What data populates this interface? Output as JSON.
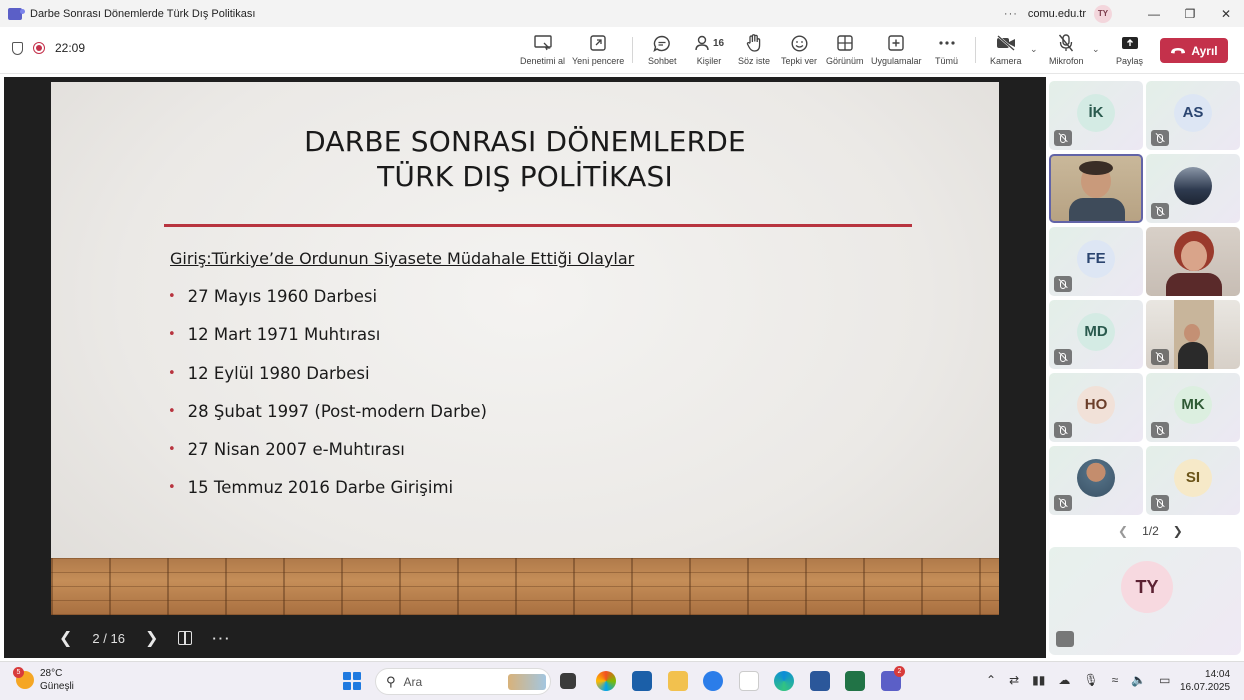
{
  "window": {
    "title": "Darbe Sonrası Dönemlerde Türk Dış Politikası",
    "more": "···",
    "domain": "comu.edu.tr",
    "user_initials": "TY"
  },
  "toolbar": {
    "duration": "22:09",
    "items": [
      {
        "label": "Denetimi al",
        "icon": "take-control-icon"
      },
      {
        "label": "Yeni pencere",
        "icon": "new-window-icon"
      },
      {
        "label": "Sohbet",
        "icon": "chat-icon"
      },
      {
        "label": "Kişiler",
        "icon": "people-icon",
        "count": "16"
      },
      {
        "label": "Söz iste",
        "icon": "raise-hand-icon"
      },
      {
        "label": "Tepki ver",
        "icon": "react-icon"
      },
      {
        "label": "Görünüm",
        "icon": "view-icon"
      },
      {
        "label": "Uygulamalar",
        "icon": "apps-icon"
      },
      {
        "label": "Tümü",
        "icon": "more-icon"
      },
      {
        "label": "Kamera",
        "icon": "camera-off-icon"
      },
      {
        "label": "Mikrofon",
        "icon": "mic-off-icon"
      },
      {
        "label": "Paylaş",
        "icon": "share-icon"
      }
    ],
    "leave_label": "Ayrıl",
    "leave_color": "#c4314b"
  },
  "slide": {
    "title_line1": "DARBE SONRASI DÖNEMLERDE",
    "title_line2": "TÜRK DIŞ POLİTİKASI",
    "subtitle": "Giriş:Türkiye’de Ordunun Siyasete Müdahale Ettiği Olaylar",
    "bullet_symbol": "•",
    "bullets": [
      "27 Mayıs 1960 Darbesi",
      "12 Mart 1971 Muhtırası",
      "12 Eylül 1980 Darbesi",
      "28 Şubat 1997 (Post-modern Darbe)",
      "27 Nisan 2007 e-Muhtırası",
      "15 Temmuz 2016 Darbe Girişimi"
    ],
    "accent_color": "#b8343f",
    "page_indicator": "2 / 16"
  },
  "participants": [
    {
      "initials": "İK",
      "avatar_bg": "#d4ebe4",
      "avatar_fg": "#2a5a4e"
    },
    {
      "initials": "AS",
      "avatar_bg": "#dde6f4",
      "avatar_fg": "#2b4570"
    },
    {
      "initials": "",
      "photo": "man-with-beard"
    },
    {
      "initials": "",
      "photo": "man-in-suit"
    },
    {
      "initials": "FE",
      "avatar_bg": "#dde6f4",
      "avatar_fg": "#2b4570"
    },
    {
      "initials": "",
      "photo": "woman-red-hair"
    },
    {
      "initials": "MD",
      "avatar_bg": "#d4ebe4",
      "avatar_fg": "#2a5a4e"
    },
    {
      "initials": "",
      "photo": "man-in-room"
    },
    {
      "initials": "HO",
      "avatar_bg": "#f1e1d8",
      "avatar_fg": "#6b3e2a"
    },
    {
      "initials": "MK",
      "avatar_bg": "#dcefe0",
      "avatar_fg": "#2f5a35"
    },
    {
      "initials": "",
      "photo": "man-outdoor"
    },
    {
      "initials": "SI",
      "avatar_bg": "#f6e9c8",
      "avatar_fg": "#6b5418"
    }
  ],
  "pager": "1/2",
  "self": {
    "initials": "TY"
  },
  "taskbar": {
    "weather_temp": "28°C",
    "weather_desc": "Güneşli",
    "weather_badge": "5",
    "search_placeholder": "Ara",
    "teams_badge": "2",
    "time": "14:04",
    "date": "16.07.2025"
  }
}
